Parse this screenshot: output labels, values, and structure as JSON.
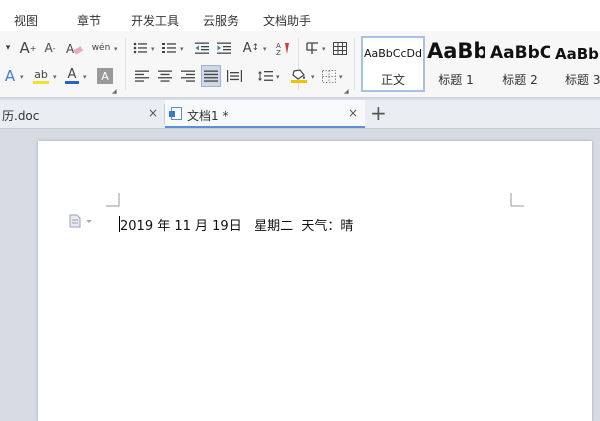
{
  "menu": {
    "items": [
      "视图",
      "章节",
      "开发工具",
      "云服务",
      "文档助手"
    ]
  },
  "ribbon": {
    "font_grow_label": "A",
    "font_shrink_label": "A",
    "phonetic_label": "wén",
    "text_effect_label": "A",
    "highlight_label": "ab",
    "font_color_label": "A",
    "char_shading_label": "A",
    "char_spacing_label": "A",
    "colors": {
      "highlight": "#f5e12a",
      "font_color": "#2a62c9",
      "text_effect": "#3d7fd6",
      "shading_fill": "#f2c400"
    }
  },
  "styles": [
    {
      "sample": "AaBbCcDd",
      "label": "正文"
    },
    {
      "sample": "AaBb",
      "label": "标题 1"
    },
    {
      "sample": "AaBbC",
      "label": "标题 2"
    },
    {
      "sample": "AaBb",
      "label": "标题 3"
    }
  ],
  "tabs": [
    {
      "title": "历.doc",
      "close": "×"
    },
    {
      "title": "文档1 *",
      "close": "×"
    }
  ],
  "new_tab_label": "+",
  "document": {
    "line": "2019 年 11 月 19日   星期二  天气：晴"
  }
}
